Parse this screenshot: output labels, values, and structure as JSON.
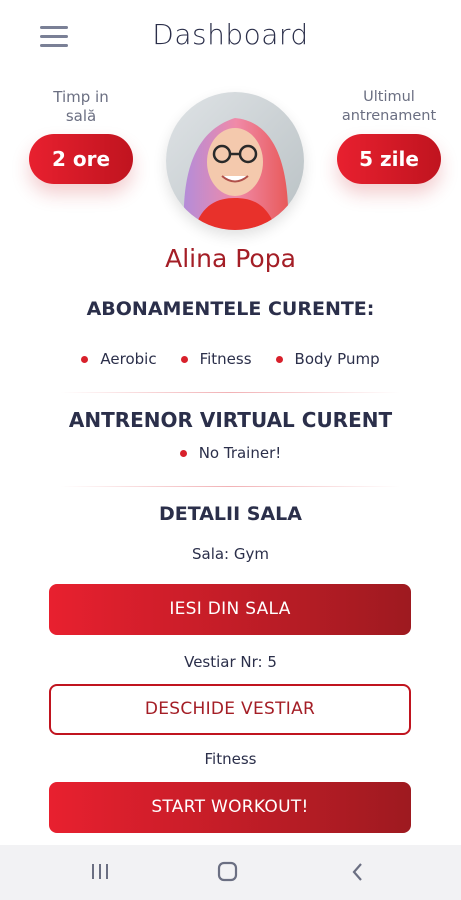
{
  "header": {
    "title": "Dashboard",
    "menu_icon": "hamburger-menu-icon"
  },
  "stats": {
    "time_label_line1": "Timp in",
    "time_label_line2": "sală",
    "time_value": "2 ore",
    "last_label_line1": "Ultimul",
    "last_label_line2": "antrenament",
    "last_value": "5 zile"
  },
  "profile": {
    "name": "Alina Popa",
    "avatar_icon": "user-photo-avatar"
  },
  "subscriptions": {
    "title": "ABONAMENTELE CURENTE:",
    "items": [
      "Aerobic",
      "Fitness",
      "Body Pump"
    ]
  },
  "trainer": {
    "title": "ANTRENOR VIRTUAL CURENT",
    "items": [
      "No Trainer!"
    ]
  },
  "gym": {
    "title": "DETALII SALA",
    "sala_text": "Sala: Gym",
    "exit_button": "IESI DIN SALA",
    "locker_text": "Vestiar Nr: 5",
    "locker_button": "DESCHIDE VESTIAR",
    "workout_text": "Fitness",
    "start_button": "START WORKOUT!"
  },
  "navbar": {
    "recent_icon": "recent-apps-icon",
    "home_icon": "home-icon",
    "back_icon": "back-icon"
  },
  "colors": {
    "accent": "#e8202f",
    "accent_dark": "#9e1a20",
    "name_color": "#a41e26",
    "text": "#2b2f4a"
  }
}
